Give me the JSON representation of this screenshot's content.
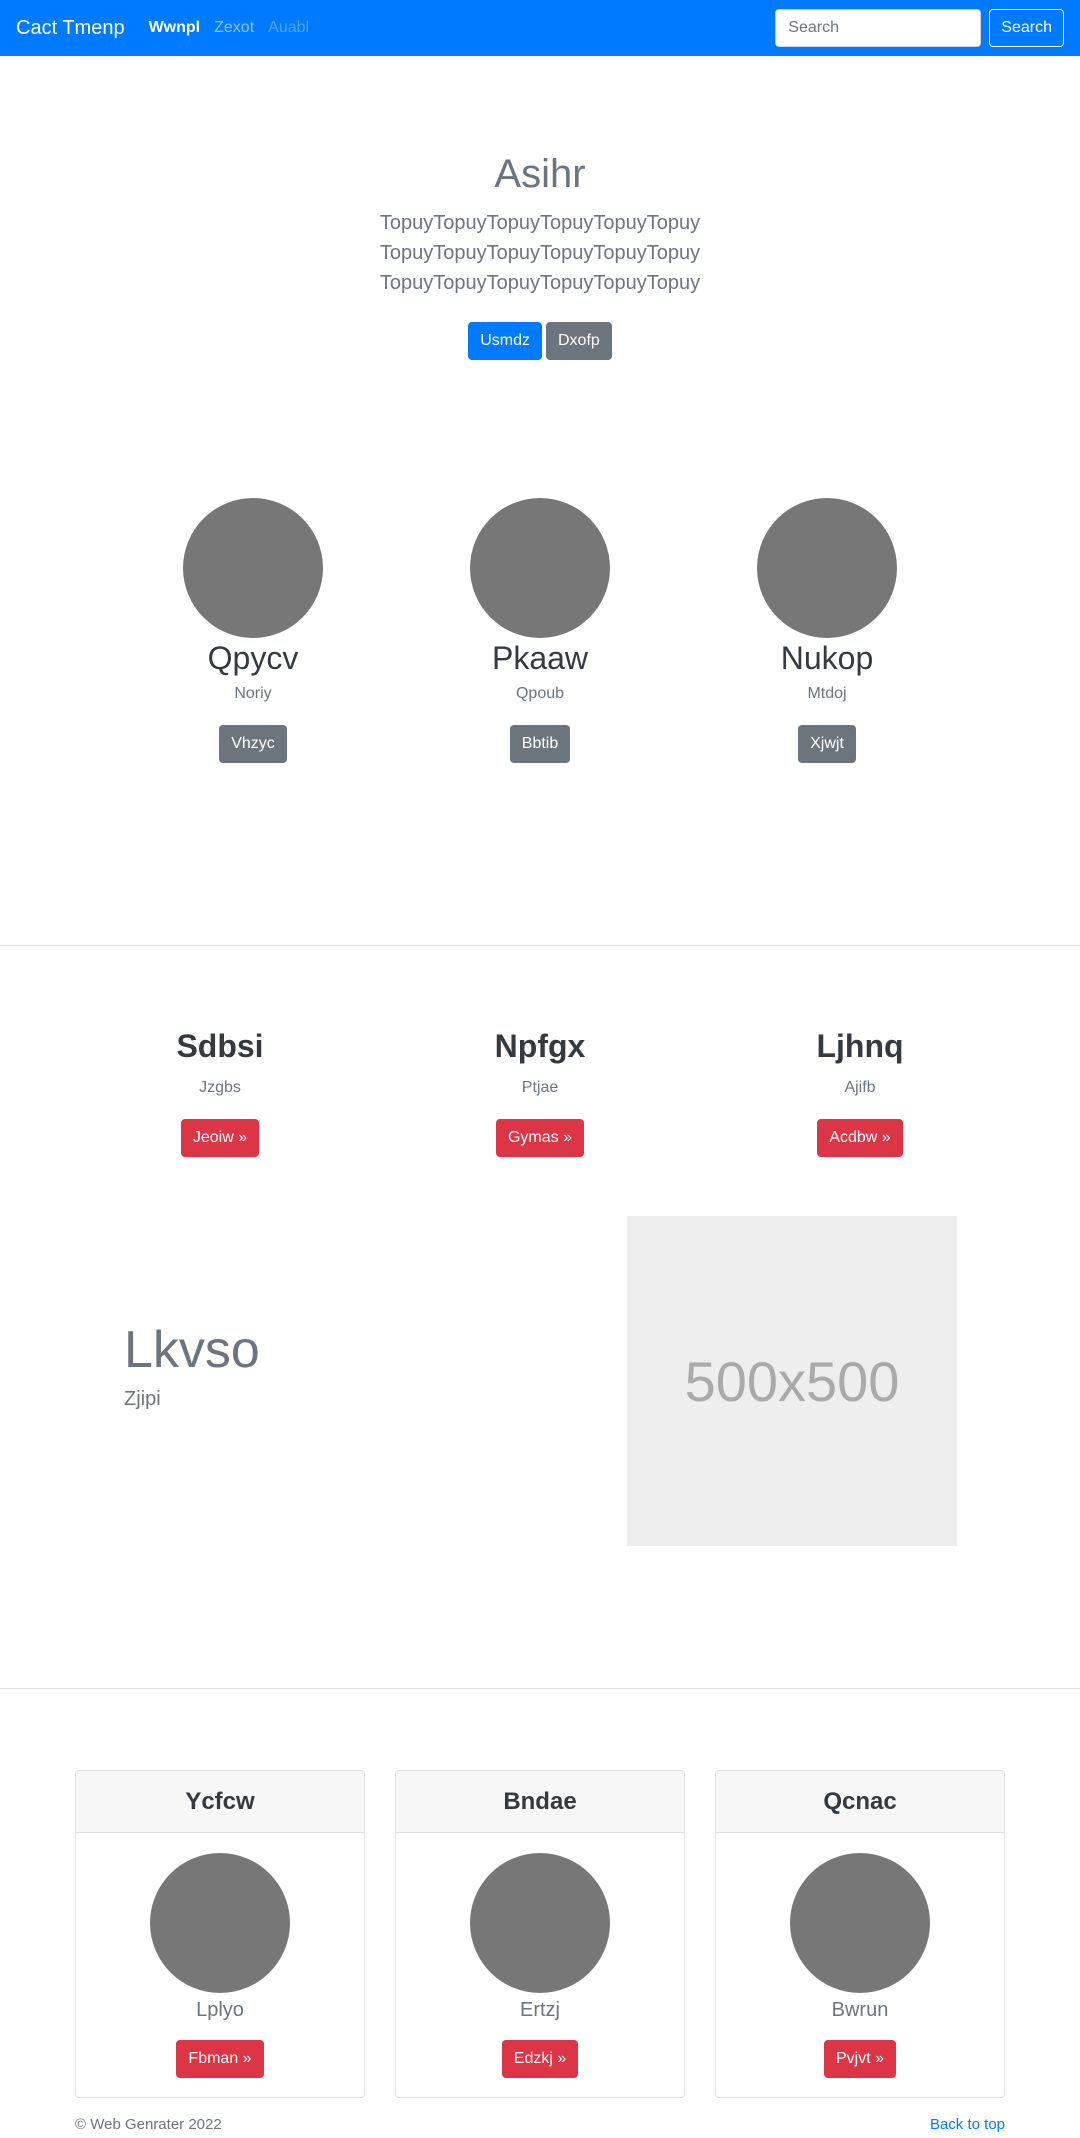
{
  "navbar": {
    "brand": "Cact Tmenp",
    "links": [
      "Wwnpl",
      "Zexot",
      "Auabl"
    ],
    "search_placeholder": "Search",
    "search_button": "Search",
    "color": "#007bff"
  },
  "hero": {
    "title": "Asihr",
    "lead": "TopuyTopuyTopuyTopuyTopuyTopuy TopuyTopuyTopuyTopuyTopuyTopuy TopuyTopuyTopuyTopuyTopuyTopuy",
    "primary_button": "Usmdz",
    "secondary_button": "Dxofp"
  },
  "profiles": [
    {
      "title": "Qpycv",
      "text": "Noriy",
      "button": "Vhzyc"
    },
    {
      "title": "Pkaaw",
      "text": "Qpoub",
      "button": "Bbtib"
    },
    {
      "title": "Nukop",
      "text": "Mtdoj",
      "button": "Xjwjt"
    }
  ],
  "features": [
    {
      "title": "Sdbsi",
      "text": "Jzgbs",
      "button": "Jeoiw »"
    },
    {
      "title": "Npfgx",
      "text": "Ptjae",
      "button": "Gymas »"
    },
    {
      "title": "Ljhnq",
      "text": "Ajifb",
      "button": "Acdbw »"
    }
  ],
  "featurette": {
    "title": "Lkvso",
    "subtitle": "Zjipi",
    "image_label": "500x500"
  },
  "cards": [
    {
      "header": "Ycfcw",
      "text": "Lplyo",
      "button": "Fbman »"
    },
    {
      "header": "Bndae",
      "text": "Ertzj",
      "button": "Edzkj »"
    },
    {
      "header": "Qcnac",
      "text": "Bwrun",
      "button": "Pvjvt »"
    }
  ],
  "footer": {
    "copyright": "© Web Genrater 2022",
    "back_to_top": "Back to top"
  }
}
